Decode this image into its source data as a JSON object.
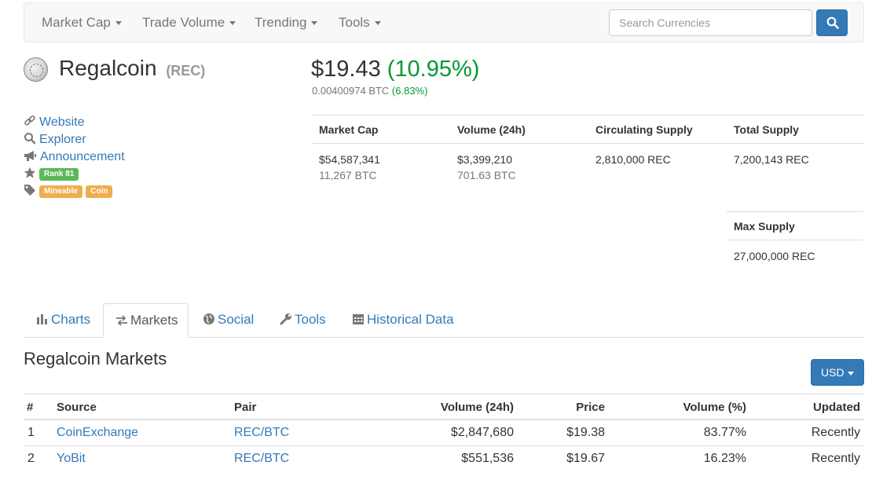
{
  "nav": {
    "items": [
      {
        "label": "Market Cap"
      },
      {
        "label": "Trade Volume"
      },
      {
        "label": "Trending"
      },
      {
        "label": "Tools"
      }
    ],
    "search_placeholder": "Search Currencies"
  },
  "coin": {
    "name": "Regalcoin",
    "symbol": "(REC)",
    "price_usd": "$19.43",
    "price_change": "(10.95%)",
    "price_btc": "0.00400974 BTC",
    "btc_change": "(6.83%)"
  },
  "links": {
    "website": "Website",
    "explorer": "Explorer",
    "announcement": "Announcement",
    "rank": "Rank 81",
    "tags": [
      "Mineable",
      "Coin"
    ]
  },
  "stats": {
    "market_cap": {
      "label": "Market Cap",
      "usd": "$54,587,341",
      "btc": "11,267 BTC"
    },
    "volume": {
      "label": "Volume (24h)",
      "usd": "$3,399,210",
      "btc": "701.63 BTC"
    },
    "circulating": {
      "label": "Circulating Supply",
      "value": "2,810,000 REC"
    },
    "total": {
      "label": "Total Supply",
      "value": "7,200,143 REC"
    },
    "max": {
      "label": "Max Supply",
      "value": "27,000,000 REC"
    }
  },
  "tabs": [
    {
      "label": "Charts",
      "icon": "bar-chart-icon"
    },
    {
      "label": "Markets",
      "icon": "exchange-icon",
      "active": true
    },
    {
      "label": "Social",
      "icon": "globe-icon"
    },
    {
      "label": "Tools",
      "icon": "wrench-icon"
    },
    {
      "label": "Historical Data",
      "icon": "calendar-icon"
    }
  ],
  "markets": {
    "title": "Regalcoin Markets",
    "currency": "USD",
    "columns": [
      "#",
      "Source",
      "Pair",
      "Volume (24h)",
      "Price",
      "Volume (%)",
      "Updated"
    ],
    "rows": [
      {
        "rank": "1",
        "source": "CoinExchange",
        "pair": "REC/BTC",
        "volume": "$2,847,680",
        "price": "$19.38",
        "volume_pct": "83.77%",
        "updated": "Recently"
      },
      {
        "rank": "2",
        "source": "YoBit",
        "pair": "REC/BTC",
        "volume": "$551,536",
        "price": "$19.67",
        "volume_pct": "16.23%",
        "updated": "Recently"
      }
    ]
  },
  "colors": {
    "link": "#337ab7",
    "positive": "#009933",
    "rank_badge": "#5cb85c",
    "tag_badge": "#f0ad4e"
  }
}
